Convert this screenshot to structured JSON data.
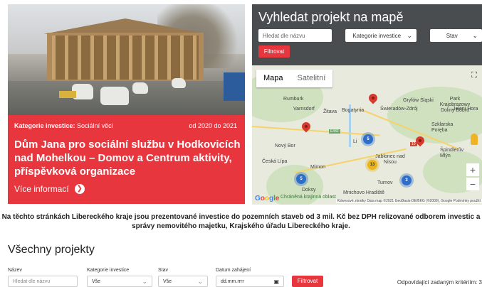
{
  "featured": {
    "category_label": "Kategorie investice:",
    "category_value": "Sociální věci",
    "dates": "od 2020 do 2021",
    "title": "Dům Jana pro sociální službu v Hodkovicích nad Mohelkou – Domov a Centrum aktivity, příspěvková organizace",
    "more_label": "Více informací",
    "accent_color": "#e8363f",
    "icon": "arrow-right-circle-icon"
  },
  "map_search": {
    "heading": "Vyhledat projekt na mapě",
    "name_placeholder": "Hledat dle názvu",
    "category_selected": "Kategorie investice",
    "status_selected": "Stav",
    "filter_label": "Filtrovat"
  },
  "map": {
    "tab_map": "Mapa",
    "tab_satellite": "Satelitní",
    "towns": [
      "Rumburk",
      "Varnsdorf",
      "Žitava",
      "Bogatynia",
      "Gryfów Śląski",
      "Park Krajobrazowy Doliny Bobru",
      "Jeleni Hora",
      "Świeradów-Zdrój",
      "Szklarska Poręba",
      "Špindlerův Mlýn",
      "Nový Bor",
      "Česká Lípa",
      "Mimon",
      "Jablonec nad Nisou",
      "Turnov",
      "Doksy",
      "Mnichovo Hradiště",
      "Chráněná krajinná oblast",
      "Li"
    ],
    "road_labels": [
      "E442",
      "10"
    ],
    "clusters": [
      {
        "label": "5",
        "color": "blue"
      },
      {
        "label": "13",
        "color": "yellow"
      },
      {
        "label": "5",
        "color": "blue"
      },
      {
        "label": "3",
        "color": "blue"
      }
    ],
    "google": "Google",
    "attribution": "Klávesové zkratky  Data map ©2021 GeoBasis-DE/BKG (©2009), Google  Podmínky použití",
    "zoom_in": "+",
    "zoom_out": "−"
  },
  "description": "Na těchto stránkách Libereckého kraje jsou prezentované investice do pozemních staveb od 3 mil. Kč bez DPH  relizované odborem investic a správy nemovitého majetku, Krajského úřadu Libereckého kraje.",
  "section_title": "Všechny projekty",
  "filters": {
    "name_label": "Název",
    "name_placeholder": "Hledat dle názvu",
    "category_label": "Kategorie investice",
    "category_value": "Vše",
    "status_label": "Stav",
    "status_value": "Vše",
    "date_label": "Datum zahájení",
    "date_placeholder": "dd.mm.rrrr",
    "filter_label": "Filtrovat",
    "result_text": "Odpovídající zadaným kritériím: 3"
  }
}
